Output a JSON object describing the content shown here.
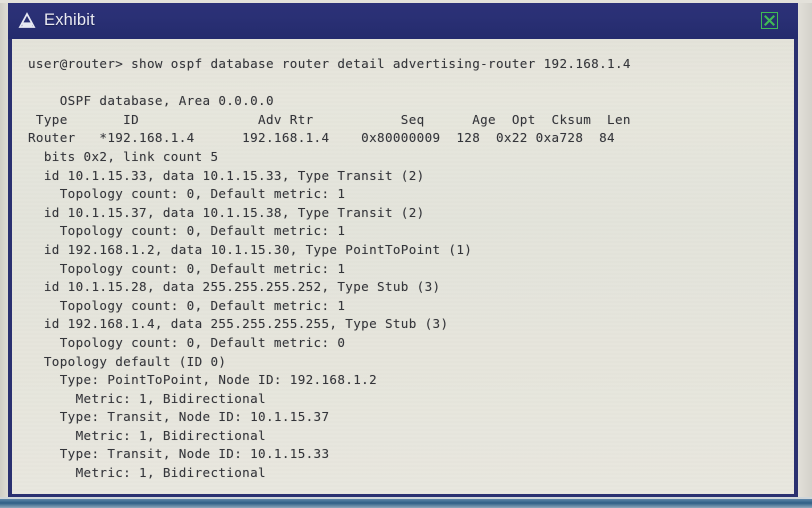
{
  "window": {
    "title": "Exhibit",
    "app_icon": "exhibit-icon",
    "close_icon": "close-icon",
    "titlebar_color": "#2a3075",
    "border_color": "#2a3070",
    "close_border_color": "#3fbb55",
    "terminal_background": "#e5e4db",
    "terminal_text_color": "#34353a"
  },
  "terminal": {
    "prompt": "user@router>",
    "command": "show ospf database router detail advertising-router 192.168.1.4",
    "lines": [
      "user@router> show ospf database router detail advertising-router 192.168.1.4",
      "",
      "    OSPF database, Area 0.0.0.0",
      " Type       ID               Adv Rtr           Seq      Age  Opt  Cksum  Len",
      "Router   *192.168.1.4      192.168.1.4    0x80000009  128  0x22 0xa728  84",
      "  bits 0x2, link count 5",
      "  id 10.1.15.33, data 10.1.15.33, Type Transit (2)",
      "    Topology count: 0, Default metric: 1",
      "  id 10.1.15.37, data 10.1.15.38, Type Transit (2)",
      "    Topology count: 0, Default metric: 1",
      "  id 192.168.1.2, data 10.1.15.30, Type PointToPoint (1)",
      "    Topology count: 0, Default metric: 1",
      "  id 10.1.15.28, data 255.255.255.252, Type Stub (3)",
      "    Topology count: 0, Default metric: 1",
      "  id 192.168.1.4, data 255.255.255.255, Type Stub (3)",
      "    Topology count: 0, Default metric: 0",
      "  Topology default (ID 0)",
      "    Type: PointToPoint, Node ID: 192.168.1.2",
      "      Metric: 1, Bidirectional",
      "    Type: Transit, Node ID: 10.1.15.37",
      "      Metric: 1, Bidirectional",
      "    Type: Transit, Node ID: 10.1.15.33",
      "      Metric: 1, Bidirectional"
    ],
    "database_header": {
      "area_line": "OSPF database, Area 0.0.0.0",
      "columns": [
        "Type",
        "ID",
        "Adv Rtr",
        "Seq",
        "Age",
        "Opt",
        "Cksum",
        "Len"
      ],
      "row": {
        "type": "Router",
        "id": "*192.168.1.4",
        "adv_rtr": "192.168.1.4",
        "seq": "0x80000009",
        "age": "128",
        "opt": "0x22",
        "cksum": "0xa728",
        "len": "84"
      }
    },
    "lsa_detail": {
      "bits": "0x2",
      "link_count": "5",
      "links": [
        {
          "id": "10.1.15.33",
          "data": "10.1.15.33",
          "type": "Transit",
          "type_code": "2",
          "topology_count": "0",
          "default_metric": "1"
        },
        {
          "id": "10.1.15.37",
          "data": "10.1.15.38",
          "type": "Transit",
          "type_code": "2",
          "topology_count": "0",
          "default_metric": "1"
        },
        {
          "id": "192.168.1.2",
          "data": "10.1.15.30",
          "type": "PointToPoint",
          "type_code": "1",
          "topology_count": "0",
          "default_metric": "1"
        },
        {
          "id": "10.1.15.28",
          "data": "255.255.255.252",
          "type": "Stub",
          "type_code": "3",
          "topology_count": "0",
          "default_metric": "1"
        },
        {
          "id": "192.168.1.4",
          "data": "255.255.255.255",
          "type": "Stub",
          "type_code": "3",
          "topology_count": "0",
          "default_metric": "0"
        }
      ],
      "topology": {
        "name": "Topology default (ID 0)",
        "neighbors": [
          {
            "type": "PointToPoint",
            "node_id": "192.168.1.2",
            "metric": "1",
            "direction": "Bidirectional"
          },
          {
            "type": "Transit",
            "node_id": "10.1.15.37",
            "metric": "1",
            "direction": "Bidirectional"
          },
          {
            "type": "Transit",
            "node_id": "10.1.15.33",
            "metric": "1",
            "direction": "Bidirectional"
          }
        ]
      }
    }
  }
}
